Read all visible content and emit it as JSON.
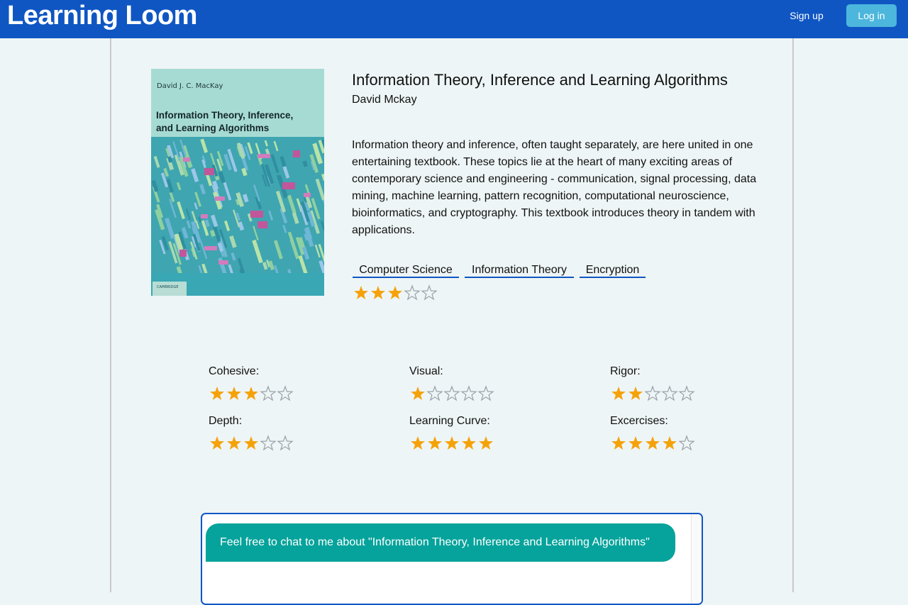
{
  "header": {
    "brand": "Learning Loom",
    "signup_label": "Sign up",
    "login_label": "Log in",
    "bg_color": "#0f56c3"
  },
  "book": {
    "title": "Information Theory, Inference and Learning Algorithms",
    "author": "David Mckay",
    "description": "Information theory and inference, often taught separately, are here united in one entertaining textbook. These topics lie at the heart of many exciting areas of contemporary science and engineering - communication, signal processing, data mining, machine learning, pattern recognition, computational neuroscience, bioinformatics, and cryptography. This textbook introduces theory in tandem with applications.",
    "tags": [
      "Computer Science",
      "Information Theory",
      "Encryption"
    ],
    "overall_rating": 3,
    "max_rating": 5,
    "cover": {
      "author_text": "David J. C. MacKay",
      "title_line1": "Information Theory, Inference,",
      "title_line2": "and Learning Algorithms",
      "publisher_mark": "CAMBRIDGE"
    }
  },
  "ratings": [
    {
      "label": "Cohesive:",
      "value": 3
    },
    {
      "label": "Visual:",
      "value": 1
    },
    {
      "label": "Rigor:",
      "value": 2
    },
    {
      "label": "Depth:",
      "value": 3
    },
    {
      "label": "Learning Curve:",
      "value": 5
    },
    {
      "label": "Excercises:",
      "value": 4
    }
  ],
  "chat": {
    "greeting": "Feel free to chat to me about \"Information Theory, Inference and Learning Algorithms\"",
    "bubble_color": "#05a39b"
  },
  "colors": {
    "star_filled": "#f5a20a",
    "star_empty": "#9aa0a6",
    "accent": "#0f56c3"
  }
}
